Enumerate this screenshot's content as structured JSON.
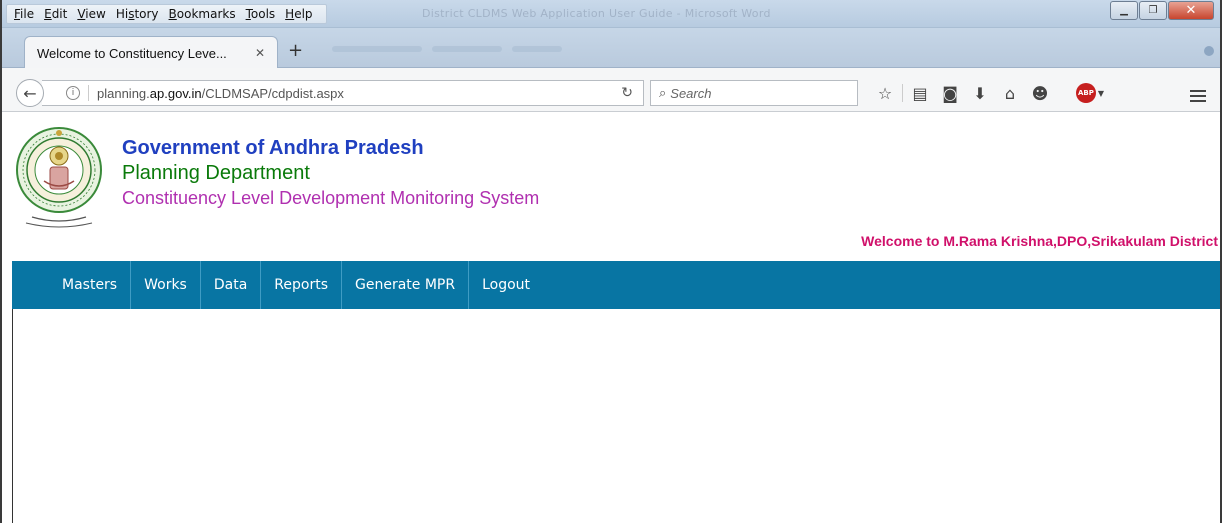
{
  "browser": {
    "menu": [
      {
        "key": "F",
        "rest": "ile"
      },
      {
        "key": "E",
        "rest": "dit"
      },
      {
        "key": "V",
        "rest": "iew"
      },
      {
        "pre": "Hi",
        "key": "s",
        "rest": "tory"
      },
      {
        "key": "B",
        "rest": "ookmarks"
      },
      {
        "key": "T",
        "rest": "ools"
      },
      {
        "key": "H",
        "rest": "elp"
      }
    ],
    "window_title": "District CLDMS Web Application User Guide - Microsoft Word",
    "tab": {
      "title": "Welcome to Constituency Leve...",
      "close_glyph": "✕"
    },
    "new_tab_glyph": "+",
    "url": {
      "prefix": "planning.",
      "domain": "ap.gov.in",
      "path": "/CLDMSAP/cdpdist.aspx"
    },
    "search_placeholder": "Search",
    "icons": [
      "star-icon",
      "reading-list-icon",
      "pocket-icon",
      "download-icon",
      "home-icon",
      "chat-icon",
      "adblock-icon",
      "menu-icon"
    ],
    "abp_label": "ABP"
  },
  "page": {
    "gov_title": "Government of Andhra Pradesh",
    "dept_title": "Planning Department",
    "system_title": "Constituency Level Development Monitoring System",
    "welcome_text": "Welcome to M.Rama Krishna,DPO,Srikakulam District",
    "nav": [
      "Masters",
      "Works",
      "Data",
      "Reports",
      "Generate MPR",
      "Logout"
    ],
    "colors": {
      "nav_bg": "#0875a3",
      "gov_title": "#2040c0",
      "dept_title": "#0a7a0a",
      "system_title": "#b030b0",
      "welcome": "#d0106a"
    }
  }
}
